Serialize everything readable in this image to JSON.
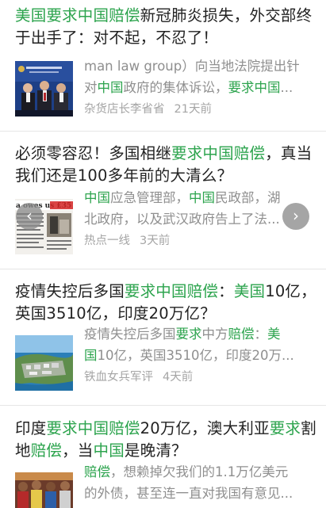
{
  "articles": [
    {
      "title_parts": [
        {
          "t": "美国要求中国赔偿",
          "hl": true
        },
        {
          "t": "新冠肺炎损失，外交部终于出手了：对不起，不忍了！",
          "hl": false
        }
      ],
      "snippet_lines": [
        [
          {
            "t": "man law group）向当地法院提出针",
            "hl": false
          }
        ],
        [
          {
            "t": "对",
            "hl": false
          },
          {
            "t": "中国",
            "hl": true
          },
          {
            "t": "政府的集体诉讼，",
            "hl": false
          },
          {
            "t": "要求中国",
            "hl": true
          },
          {
            "t": "...",
            "hl": false
          }
        ]
      ],
      "source": "杂货店长李省省",
      "time": "21天前",
      "thumb_icon": "diplomats-press-photo"
    },
    {
      "title_parts": [
        {
          "t": "必须零容忍！多国相继",
          "hl": false
        },
        {
          "t": "要求中国赔偿",
          "hl": true
        },
        {
          "t": "，真当我们还是100多年前的大清么？",
          "hl": false
        }
      ],
      "snippet_lines": [
        [
          {
            "t": "中国",
            "hl": true
          },
          {
            "t": "应急管理部，",
            "hl": false
          },
          {
            "t": "中国",
            "hl": true
          },
          {
            "t": "民政部，湖",
            "hl": false
          }
        ],
        [
          {
            "t": "北政府，以及武汉政府告上了法...",
            "hl": false
          }
        ]
      ],
      "source": "热点一线",
      "time": "3天前",
      "thumb_text": "a owes us £351 BILL",
      "thumb_icon": "newspaper-clipping"
    },
    {
      "title_parts": [
        {
          "t": "疫情失控后多国",
          "hl": false
        },
        {
          "t": "要求中国赔偿",
          "hl": true
        },
        {
          "t": "：",
          "hl": false
        },
        {
          "t": "美国",
          "hl": true
        },
        {
          "t": "10亿，英国3510亿，印度20万亿？",
          "hl": false
        }
      ],
      "snippet_lines": [
        [
          {
            "t": "疫情失控后多国",
            "hl": false
          },
          {
            "t": "要求",
            "hl": true
          },
          {
            "t": "中方",
            "hl": false
          },
          {
            "t": "赔偿",
            "hl": true
          },
          {
            "t": "：",
            "hl": false
          },
          {
            "t": "美",
            "hl": true
          }
        ],
        [
          {
            "t": "国",
            "hl": true
          },
          {
            "t": "10亿，英国3510亿，印度20万...",
            "hl": false
          }
        ]
      ],
      "source": "铁血女兵军评",
      "time": "4天前",
      "thumb_icon": "island-aerial-photo"
    },
    {
      "title_parts": [
        {
          "t": "印度",
          "hl": false
        },
        {
          "t": "要求中国赔偿",
          "hl": true
        },
        {
          "t": "20万亿，澳大利亚",
          "hl": false
        },
        {
          "t": "要求",
          "hl": true
        },
        {
          "t": "割地",
          "hl": false
        },
        {
          "t": "赔偿",
          "hl": true
        },
        {
          "t": "，当",
          "hl": false
        },
        {
          "t": "中国",
          "hl": true
        },
        {
          "t": "是晚清？",
          "hl": false
        }
      ],
      "snippet_lines": [
        [
          {
            "t": "赔偿",
            "hl": true
          },
          {
            "t": "，想赖掉欠我们的1.1万亿美元",
            "hl": false
          }
        ],
        [
          {
            "t": "的外债，甚至连一直对我国有意见...",
            "hl": false
          }
        ]
      ],
      "thumb_icon": "crowd-photo"
    }
  ],
  "carousel": {
    "prev_icon": "chevron-left-icon",
    "next_icon": "chevron-right-icon",
    "prev_glyph": "‹",
    "next_glyph": "›"
  },
  "colors": {
    "highlight": "#2da44e",
    "meta": "#a5a5a5",
    "snippet": "#8f8f8f"
  }
}
